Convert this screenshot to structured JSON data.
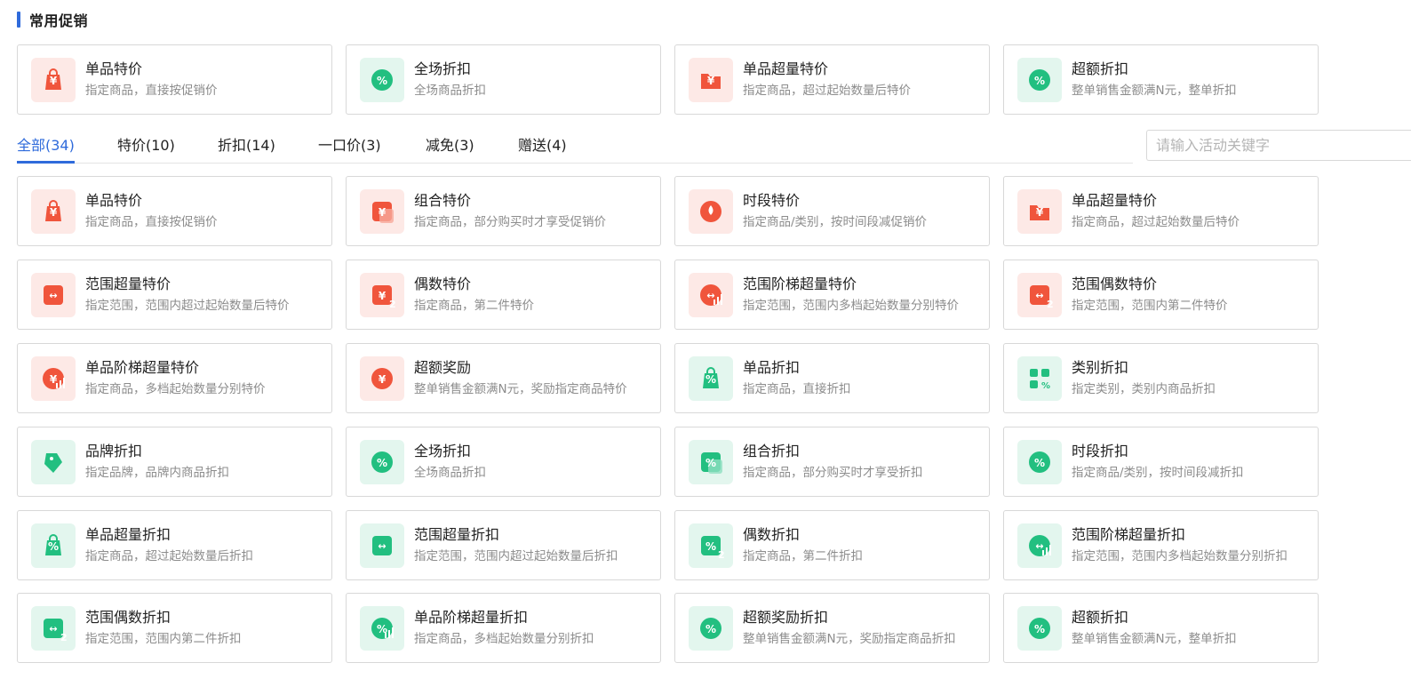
{
  "section": {
    "title": "常用促销"
  },
  "common": [
    {
      "title": "单品特价",
      "desc": "指定商品，直接按促销价",
      "color": "red",
      "icon": "price-tag-bag-icon"
    },
    {
      "title": "全场折扣",
      "desc": "全场商品折扣",
      "color": "green",
      "icon": "percent-circle-icon"
    },
    {
      "title": "单品超量特价",
      "desc": "指定商品，超过起始数量后特价",
      "color": "red",
      "icon": "bulk-price-folder-icon"
    },
    {
      "title": "超额折扣",
      "desc": "整单销售金额满N元，整单折扣",
      "color": "green",
      "icon": "percent-arrow-icon"
    }
  ],
  "tabs": [
    {
      "label": "全部(34)",
      "active": true
    },
    {
      "label": "特价(10)"
    },
    {
      "label": "折扣(14)"
    },
    {
      "label": "一口价(3)"
    },
    {
      "label": "减免(3)"
    },
    {
      "label": "赠送(4)"
    }
  ],
  "search": {
    "placeholder": "请输入活动关键字"
  },
  "items": [
    {
      "title": "单品特价",
      "desc": "指定商品，直接按促销价",
      "color": "red",
      "icon": "price-tag-bag-icon"
    },
    {
      "title": "组合特价",
      "desc": "指定商品，部分购买时才享受促销价",
      "color": "red",
      "icon": "combo-price-icon"
    },
    {
      "title": "时段特价",
      "desc": "指定商品/类别，按时间段减促销价",
      "color": "red",
      "icon": "timer-drop-icon"
    },
    {
      "title": "单品超量特价",
      "desc": "指定商品，超过起始数量后特价",
      "color": "red",
      "icon": "bulk-price-folder-icon"
    },
    {
      "title": "范围超量特价",
      "desc": "指定范围，范围内超过起始数量后特价",
      "color": "red",
      "icon": "range-bulk-icon"
    },
    {
      "title": "偶数特价",
      "desc": "指定商品，第二件特价",
      "color": "red",
      "icon": "even-number-icon"
    },
    {
      "title": "范围阶梯超量特价",
      "desc": "指定范围，范围内多档起始数量分别特价",
      "color": "red",
      "icon": "range-tier-icon"
    },
    {
      "title": "范围偶数特价",
      "desc": "指定范围，范围内第二件特价",
      "color": "red",
      "icon": "range-even-icon"
    },
    {
      "title": "单品阶梯超量特价",
      "desc": "指定商品，多档起始数量分别特价",
      "color": "red",
      "icon": "tier-price-icon"
    },
    {
      "title": "超额奖励",
      "desc": "整单销售金额满N元，奖励指定商品特价",
      "color": "red",
      "icon": "reward-arrow-icon"
    },
    {
      "title": "单品折扣",
      "desc": "指定商品，直接折扣",
      "color": "green",
      "icon": "bag-percent-icon"
    },
    {
      "title": "类别折扣",
      "desc": "指定类别，类别内商品折扣",
      "color": "green",
      "icon": "category-grid-icon"
    },
    {
      "title": "品牌折扣",
      "desc": "指定品牌，品牌内商品折扣",
      "color": "green",
      "icon": "brand-tag-icon"
    },
    {
      "title": "全场折扣",
      "desc": "全场商品折扣",
      "color": "green",
      "icon": "percent-circle-icon"
    },
    {
      "title": "组合折扣",
      "desc": "指定商品，部分购买时才享受折扣",
      "color": "green",
      "icon": "combo-percent-icon"
    },
    {
      "title": "时段折扣",
      "desc": "指定商品/类别，按时间段减折扣",
      "color": "green",
      "icon": "timer-percent-icon"
    },
    {
      "title": "单品超量折扣",
      "desc": "指定商品，超过起始数量后折扣",
      "color": "green",
      "icon": "bulk-percent-bag-icon"
    },
    {
      "title": "范围超量折扣",
      "desc": "指定范围，范围内超过起始数量后折扣",
      "color": "green",
      "icon": "range-bulk-green-icon"
    },
    {
      "title": "偶数折扣",
      "desc": "指定商品，第二件折扣",
      "color": "green",
      "icon": "even-percent-icon"
    },
    {
      "title": "范围阶梯超量折扣",
      "desc": "指定范围，范围内多档起始数量分别折扣",
      "color": "green",
      "icon": "range-tier-green-icon"
    },
    {
      "title": "范围偶数折扣",
      "desc": "指定范围，范围内第二件折扣",
      "color": "green",
      "icon": "range-even-green-icon"
    },
    {
      "title": "单品阶梯超量折扣",
      "desc": "指定商品，多档起始数量分别折扣",
      "color": "green",
      "icon": "tier-percent-icon"
    },
    {
      "title": "超额奖励折扣",
      "desc": "整单销售金额满N元，奖励指定商品折扣",
      "color": "green",
      "icon": "reward-percent-icon"
    },
    {
      "title": "超额折扣",
      "desc": "整单销售金额满N元，整单折扣",
      "color": "green",
      "icon": "percent-arrow-icon"
    }
  ],
  "colors": {
    "accent": "#2f6bdb",
    "red": "#f0553c",
    "green": "#22bf80"
  }
}
